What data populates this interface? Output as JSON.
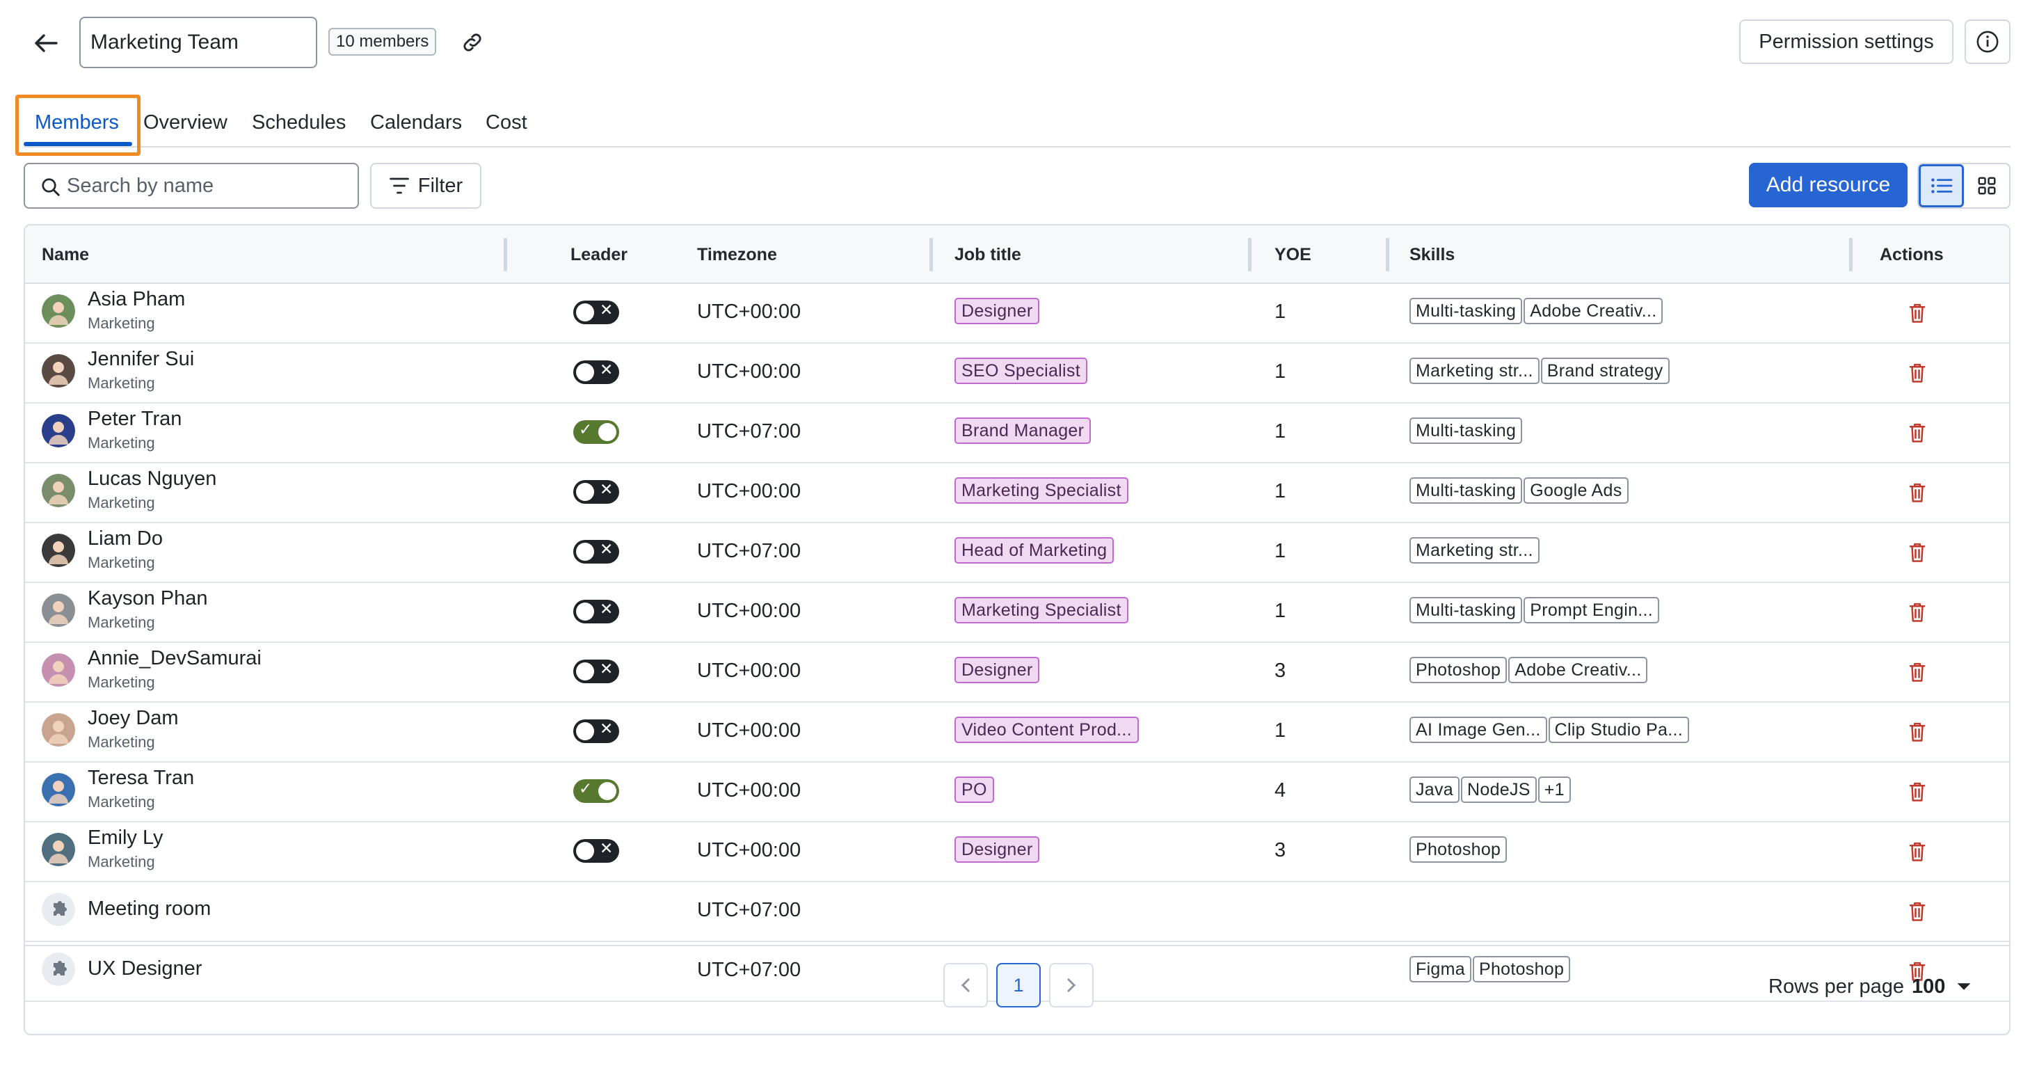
{
  "header": {
    "team_name": "Marketing Team",
    "members_badge": "10 members",
    "permission_label": "Permission settings"
  },
  "tabs": [
    {
      "label": "Members",
      "active": true
    },
    {
      "label": "Overview"
    },
    {
      "label": "Schedules"
    },
    {
      "label": "Calendars"
    },
    {
      "label": "Cost"
    }
  ],
  "toolbar": {
    "search_placeholder": "Search by name",
    "filter_label": "Filter",
    "add_label": "Add resource",
    "view_mode": "list"
  },
  "table": {
    "columns": [
      "Name",
      "Leader",
      "Timezone",
      "Job title",
      "YOE",
      "Skills",
      "Actions"
    ],
    "rows": [
      {
        "name": "Asia Pham",
        "dept": "Marketing",
        "leader": false,
        "tz": "UTC+00:00",
        "job": "Designer",
        "yoe": "1",
        "skills": [
          "Multi-tasking",
          "Adobe Creativ..."
        ],
        "avatar": "#6b8e5a"
      },
      {
        "name": "Jennifer Sui",
        "dept": "Marketing",
        "leader": false,
        "tz": "UTC+00:00",
        "job": "SEO Specialist",
        "yoe": "1",
        "skills": [
          "Marketing str...",
          "Brand strategy"
        ],
        "avatar": "#5a4a44"
      },
      {
        "name": "Peter Tran",
        "dept": "Marketing",
        "leader": true,
        "tz": "UTC+07:00",
        "job": "Brand Manager",
        "yoe": "1",
        "skills": [
          "Multi-tasking"
        ],
        "avatar": "#2a3f8c"
      },
      {
        "name": "Lucas Nguyen",
        "dept": "Marketing",
        "leader": false,
        "tz": "UTC+00:00",
        "job": "Marketing Specialist",
        "yoe": "1",
        "skills": [
          "Multi-tasking",
          "Google Ads"
        ],
        "avatar": "#7a8d6a"
      },
      {
        "name": "Liam Do",
        "dept": "Marketing",
        "leader": false,
        "tz": "UTC+07:00",
        "job": "Head of Marketing",
        "yoe": "1",
        "skills": [
          "Marketing str..."
        ],
        "avatar": "#3a3a3a"
      },
      {
        "name": "Kayson Phan",
        "dept": "Marketing",
        "leader": false,
        "tz": "UTC+00:00",
        "job": "Marketing Specialist",
        "yoe": "1",
        "skills": [
          "Multi-tasking",
          "Prompt Engin..."
        ],
        "avatar": "#8a8f94"
      },
      {
        "name": "Annie_DevSamurai",
        "dept": "Marketing",
        "leader": false,
        "tz": "UTC+00:00",
        "job": "Designer",
        "yoe": "3",
        "skills": [
          "Photoshop",
          "Adobe Creativ..."
        ],
        "avatar": "#c58fb0"
      },
      {
        "name": "Joey Dam",
        "dept": "Marketing",
        "leader": false,
        "tz": "UTC+00:00",
        "job": "Video Content Prod...",
        "yoe": "1",
        "skills": [
          "AI Image Gen...",
          "Clip Studio Pa..."
        ],
        "avatar": "#c9a48f"
      },
      {
        "name": "Teresa Tran",
        "dept": "Marketing",
        "leader": true,
        "tz": "UTC+00:00",
        "job": "PO",
        "yoe": "4",
        "skills": [
          "Java",
          "NodeJS",
          "+1"
        ],
        "avatar": "#3a6fb0"
      },
      {
        "name": "Emily Ly",
        "dept": "Marketing",
        "leader": false,
        "tz": "UTC+00:00",
        "job": "Designer",
        "yoe": "3",
        "skills": [
          "Photoshop"
        ],
        "avatar": "#4f6f80"
      },
      {
        "name": "Meeting room",
        "dept": "",
        "leader": null,
        "tz": "UTC+07:00",
        "job": "",
        "yoe": "",
        "skills": [],
        "avatar": "resource"
      },
      {
        "name": "UX Designer",
        "dept": "",
        "leader": null,
        "tz": "UTC+07:00",
        "job": "",
        "yoe": "",
        "skills": [
          "Figma",
          "Photoshop"
        ],
        "avatar": "resource"
      }
    ]
  },
  "pagination": {
    "current_page": "1",
    "rows_per_page_label": "Rows per page",
    "rows_per_page": "100"
  },
  "colors": {
    "accent": "#2765d3",
    "focus_outline": "#f08a24",
    "toggle_on": "#56792f",
    "tag_bg": "#f1d9f4",
    "delete_icon": "#c0392b"
  }
}
